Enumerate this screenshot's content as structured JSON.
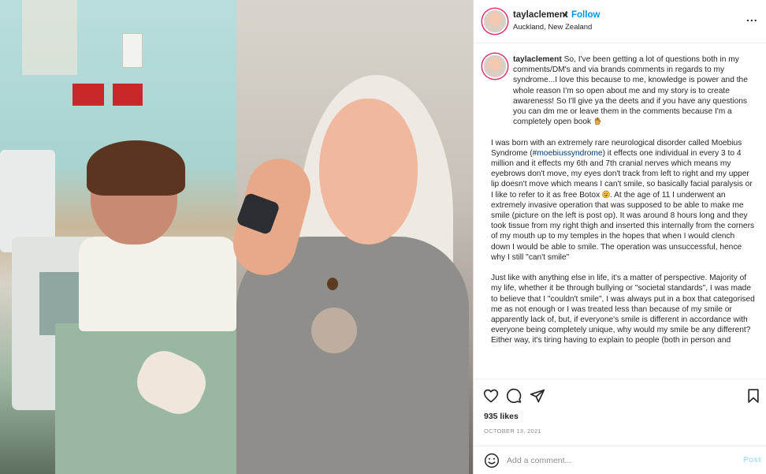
{
  "post": {
    "username": "taylaclement",
    "separator": "•",
    "follow_label": "Follow",
    "location": "Auckland, New Zealand",
    "more_label": "..."
  },
  "caption": {
    "username": "taylaclement",
    "p1_text": "So, I've been getting a lot of questions both in my comments/DM's and via brands comments in regards to my syndrome...I love this because to me, knowledge is power and the whole reason I'm so open about me and my story is to create awareness! So I'll give ya the deets and if you have any questions you can dm me or leave them in the comments because I'm a completely open book",
    "p2_before": "I was born with an extremely rare neurological disorder called Moebius Syndrome (",
    "hashtag": "#moebiussyndrome",
    "p2_after": ") it effects one individual in every 3 to 4 million and it effects my 6th and 7th cranial nerves which means my eyebrows don't move, my eyes don't track from left to right and my upper lip doesn't move which means I can't smile, so basically facial paralysis or I like to refer to it as free Botox",
    "p2_end": ". At the age of 11 I underwent an extremely invasive operation that was supposed to be able to make me smile (picture on the left is post op). It was around 8 hours long and they took tissue from my right thigh and inserted this internally from the corners of my mouth up to my temples in the hopes that when I would clench down I would be able to smile. The operation was unsuccessful, hence why I still \"can't smile\"",
    "p3_text": "Just like with anything else in life, it's a matter of perspective. Majority of my life, whether it be through bullying or \"societal standards\", I was made to believe that I \"couldn't smile\", I was always put in a box that categorised me as not enough or I was treated less than because of my smile or apparently lack of, but, if everyone's smile is different in accordance with everyone being completely unique, why would my smile be any different? Either way, it's tiring having to explain to people (both in person and"
  },
  "stats": {
    "likes": "935 likes",
    "date": "OCTOBER 13, 2021"
  },
  "comment_box": {
    "placeholder": "Add a comment...",
    "post_label": "Post"
  },
  "colors": {
    "link_blue": "#0095f6",
    "hashtag": "#00376b",
    "post_disabled": "#b2dffc"
  },
  "icons": [
    "heart-icon",
    "comment-icon",
    "share-icon",
    "bookmark-icon",
    "smile-icon",
    "hand-emoji-icon",
    "grin-emoji-icon"
  ]
}
